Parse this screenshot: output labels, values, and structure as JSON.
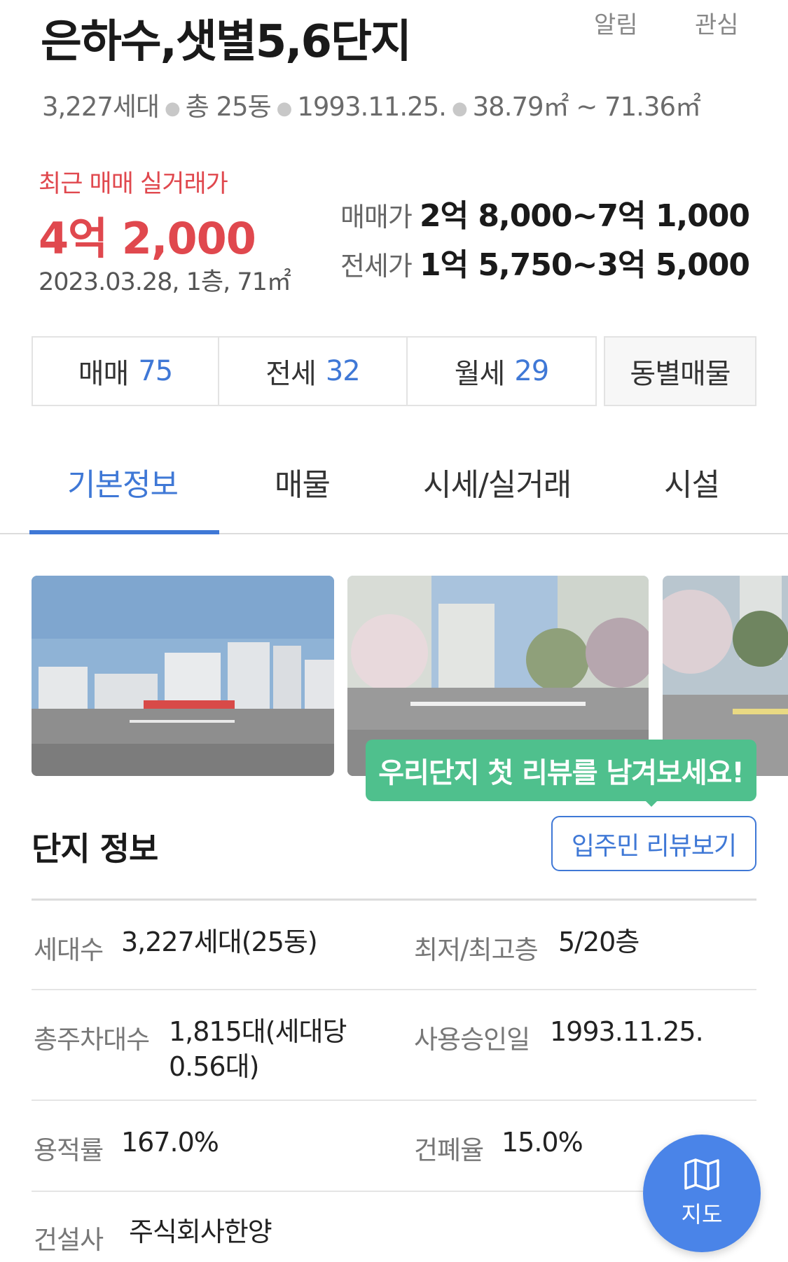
{
  "header": {
    "title": "은하수,샛별5,6단지",
    "alarm_label": "알림",
    "favorite_label": "관심"
  },
  "summary": {
    "households": "3,227세대",
    "buildings": "총 25동",
    "approval_date": "1993.11.25.",
    "area_range": "38.79㎡ ~ 71.36㎡"
  },
  "recent_trade": {
    "label": "최근 매매 실거래가",
    "price": "4억 2,000",
    "detail": "2023.03.28, 1층, 71㎡"
  },
  "price_range": {
    "sale_label": "매매가",
    "sale_value": "2억 8,000~7억 1,000",
    "jeonse_label": "전세가",
    "jeonse_value": "1억 5,750~3억 5,000"
  },
  "listing_counts": [
    {
      "label": "매매",
      "count": "75"
    },
    {
      "label": "전세",
      "count": "32"
    },
    {
      "label": "월세",
      "count": "29"
    }
  ],
  "by_building_label": "동별매물",
  "tabs": [
    {
      "label": "기본정보",
      "active": true
    },
    {
      "label": "매물",
      "active": false
    },
    {
      "label": "시세/실거래",
      "active": false
    },
    {
      "label": "시설",
      "active": false
    }
  ],
  "review_prompt": "우리단지 첫 리뷰를 남겨보세요!",
  "section": {
    "title": "단지 정보",
    "review_button": "입주민 리뷰보기"
  },
  "info": {
    "households_label": "세대수",
    "households_value": "3,227세대(25동)",
    "floors_label": "최저/최고층",
    "floors_value": "5/20층",
    "parking_label": "총주차대수",
    "parking_value": "1,815대(세대당 0.56대)",
    "approval_label": "사용승인일",
    "approval_value": "1993.11.25.",
    "far_label": "용적률",
    "far_value": "167.0%",
    "bcr_label": "건폐율",
    "bcr_value": "15.0%",
    "builder_label": "건설사",
    "builder_value": "주식회사한양"
  },
  "map_button": {
    "label": "지도",
    "icon": "map-icon"
  },
  "colors": {
    "accent_blue": "#3f78d6",
    "price_red": "#e0484e",
    "review_green": "#4fc08d",
    "fab_blue": "#4a84e8"
  }
}
